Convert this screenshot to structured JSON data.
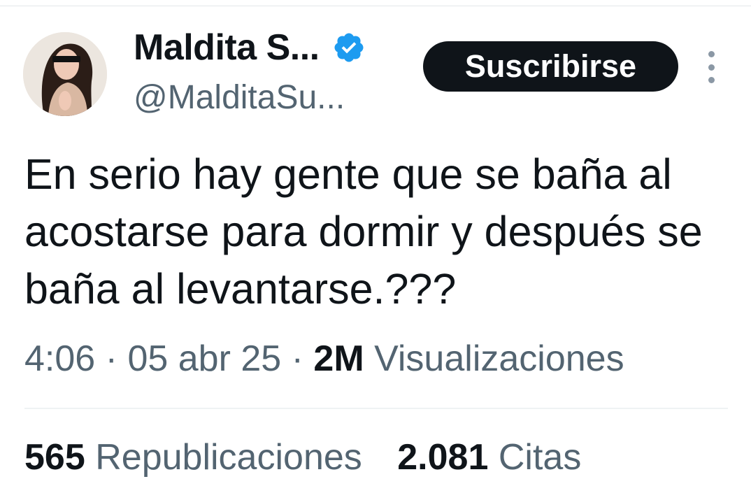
{
  "author": {
    "display_name": "Maldita S...",
    "handle": "@MalditaSu...",
    "verified": true,
    "verified_color": "#1d9bf0"
  },
  "actions": {
    "subscribe_label": "Suscribirse",
    "more_icon": "more-vertical-icon"
  },
  "tweet": {
    "text": "En serio hay gente que se baña al acostarse para dormir y después se baña al levantarse.???"
  },
  "meta": {
    "time": "4:06",
    "separator": "·",
    "date": "05 abr 25",
    "views_count": "2M",
    "views_label": "Visualizaciones"
  },
  "stats": {
    "reposts_count": "565",
    "reposts_label": "Republicaciones",
    "quotes_count": "2.081",
    "quotes_label": "Citas"
  }
}
